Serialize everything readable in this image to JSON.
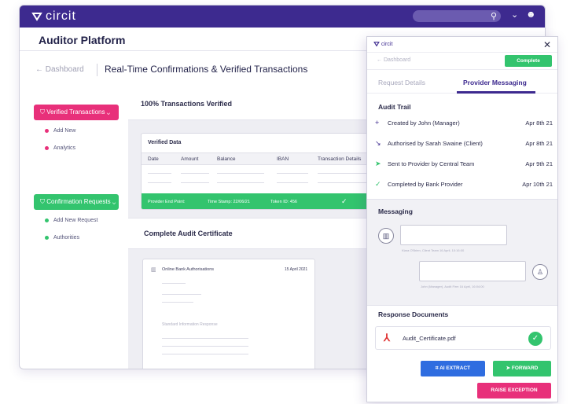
{
  "topbar": {
    "logo": "circit"
  },
  "header": {
    "platform": "Auditor Platform"
  },
  "breadcrumb": {
    "back": "← Dashboard",
    "title": "Real-Time Confirmations & Verified Transactions"
  },
  "sidebar": {
    "group1": {
      "label": "Verified Transactions",
      "items": [
        "Add New",
        "Analytics"
      ]
    },
    "group2": {
      "label": "Confirmation Requests",
      "items": [
        "Add New Request",
        "Authorities"
      ]
    }
  },
  "content": {
    "card1_title": "100% Transactions Verified",
    "verified_data": {
      "title": "Verified Data",
      "columns": [
        "Date",
        "Amount",
        "Balance",
        "IBAN",
        "Transaction Details"
      ],
      "footer": [
        "Provider End Point:",
        "Time Stamp: 22/06/21",
        "Token ID: 456"
      ],
      "footer_check": "✓"
    },
    "card2_title": "Complete Audit Certificate",
    "certificate": {
      "title": "Online Bank Authorisations",
      "date": "15 April 2021",
      "subtitle": "Standard Information Response"
    }
  },
  "panel": {
    "logo": "circit",
    "close": "✕",
    "back": "← Dashboard",
    "complete_label": "Complete",
    "tabs": [
      "Request Details",
      "Provider Messaging"
    ],
    "audit_trail_title": "Audit Trail",
    "audit_trail": [
      {
        "label": "Created by John (Manager)",
        "date": "Apr 8th 21",
        "icon": "+",
        "color": "#3d2a8f"
      },
      {
        "label": "Authorised by Sarah Swaine (Client)",
        "date": "Apr 8th 21",
        "icon": "↘",
        "color": "#3d2a8f"
      },
      {
        "label": "Sent to Provider by Central Team",
        "date": "Apr 9th 21",
        "icon": "➤",
        "color": "#33c46e"
      },
      {
        "label": "Completed by Bank Provider",
        "date": "Apr 10th 21",
        "icon": "✓",
        "color": "#33c46e"
      }
    ],
    "messaging_title": "Messaging",
    "messages": [
      {
        "meta": "Kiara O'Brien, Client Team   16 April, 10:16:00"
      },
      {
        "meta": "John (Manager), Audit Firm   16 April, 16:04:00"
      }
    ],
    "response_docs_title": "Response Documents",
    "doc_name": "Audit_Certificate.pdf",
    "buttons": {
      "ai_extract": "AI EXTRACT",
      "forward": "FORWARD",
      "raise": "RAISE EXCEPTION"
    }
  },
  "colors": {
    "brand": "#3d2a8f",
    "green": "#33c46e",
    "pink": "#e8307a",
    "blue": "#2f6de0"
  }
}
